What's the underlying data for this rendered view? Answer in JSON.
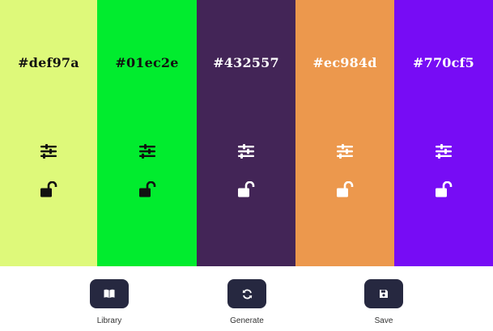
{
  "swatches": [
    {
      "hex": "#def97a",
      "color": "#def97a",
      "text_color": "#111111",
      "adjust_icon": "sliders-icon",
      "lock_icon": "unlocked-icon"
    },
    {
      "hex": "#01ec2e",
      "color": "#01ec2e",
      "text_color": "#111111",
      "adjust_icon": "sliders-icon",
      "lock_icon": "unlocked-icon"
    },
    {
      "hex": "#432557",
      "color": "#432557",
      "text_color": "#ffffff",
      "adjust_icon": "sliders-icon",
      "lock_icon": "unlocked-icon"
    },
    {
      "hex": "#ec984d",
      "color": "#ec984d",
      "text_color": "#ffffff",
      "adjust_icon": "sliders-icon",
      "lock_icon": "unlocked-icon"
    },
    {
      "hex": "#770cf5",
      "color": "#770cf5",
      "text_color": "#ffffff",
      "adjust_icon": "sliders-icon",
      "lock_icon": "unlocked-icon"
    }
  ],
  "toolbar": {
    "library": {
      "label": "Library",
      "icon": "book-icon"
    },
    "generate": {
      "label": "Generate",
      "icon": "refresh-icon"
    },
    "save": {
      "label": "Save",
      "icon": "save-icon"
    },
    "button_color": "#262840"
  }
}
